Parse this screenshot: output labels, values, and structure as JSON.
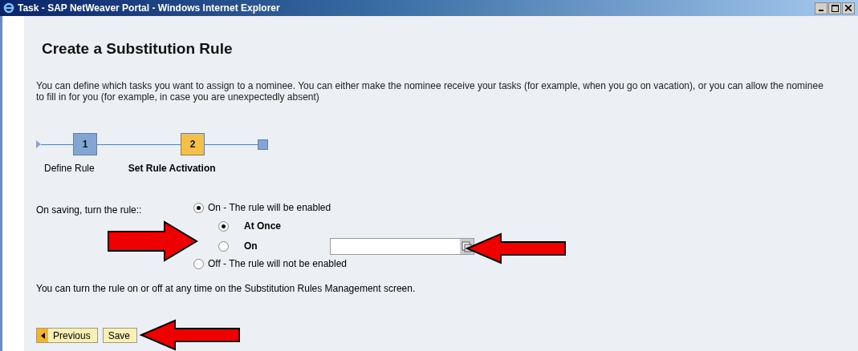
{
  "window": {
    "title": "Task - SAP NetWeaver Portal - Windows Internet Explorer"
  },
  "heading": "Create a Substitution Rule",
  "intro": "You can define which tasks you want to assign to a nominee. You can either make the nominee receive your tasks (for example, when you go on vacation), or you can allow the nominee to fill in for you (for example, in case you are unexpectedly absent)",
  "roadmap": [
    {
      "number": "1",
      "label": "Define Rule",
      "selected": false
    },
    {
      "number": "2",
      "label": "Set Rule Activation",
      "selected": true
    }
  ],
  "activation": {
    "label": "On saving, turn the rule::",
    "options": [
      {
        "label": "On - The rule will be enabled",
        "selected": true,
        "children": [
          {
            "label": "At Once",
            "selected": true
          },
          {
            "label": "On",
            "selected": false,
            "date_field": true
          }
        ]
      },
      {
        "label": "Off - The rule will not be enabled",
        "selected": false
      }
    ]
  },
  "note": "You can turn the rule on or off at any time on the Substitution Rules Management screen.",
  "buttons": [
    {
      "label": "Previous",
      "kind": "back"
    },
    {
      "label": "Save",
      "kind": "plain"
    }
  ],
  "annotations": [
    {
      "kind": "arrow-right"
    },
    {
      "kind": "arrow-left"
    },
    {
      "kind": "arrow-left"
    }
  ]
}
